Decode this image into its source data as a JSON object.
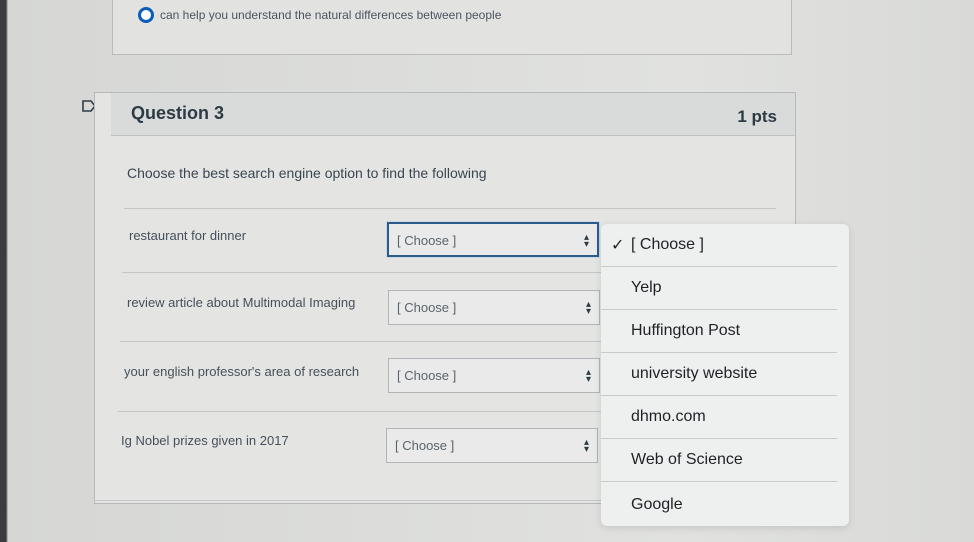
{
  "previous_question": {
    "selected_answer": "can help you understand the natural differences between people"
  },
  "question": {
    "title": "Question 3",
    "points": "1 pts",
    "prompt": "Choose the best search engine option to find the following",
    "rows": [
      {
        "label": "restaurant for dinner",
        "value": "[ Choose ]"
      },
      {
        "label": "review article about Multimodal Imaging",
        "value": "[ Choose ]"
      },
      {
        "label": "your english professor's area of research",
        "value": "[ Choose ]"
      },
      {
        "label": "Ig Nobel prizes given in 2017",
        "value": "[ Choose ]"
      }
    ]
  },
  "dropdown": {
    "options": [
      "[ Choose ]",
      "Yelp",
      "Huffington Post",
      "university website",
      "dhmo.com",
      "Web of Science",
      "Google"
    ],
    "checked_index": 0
  }
}
